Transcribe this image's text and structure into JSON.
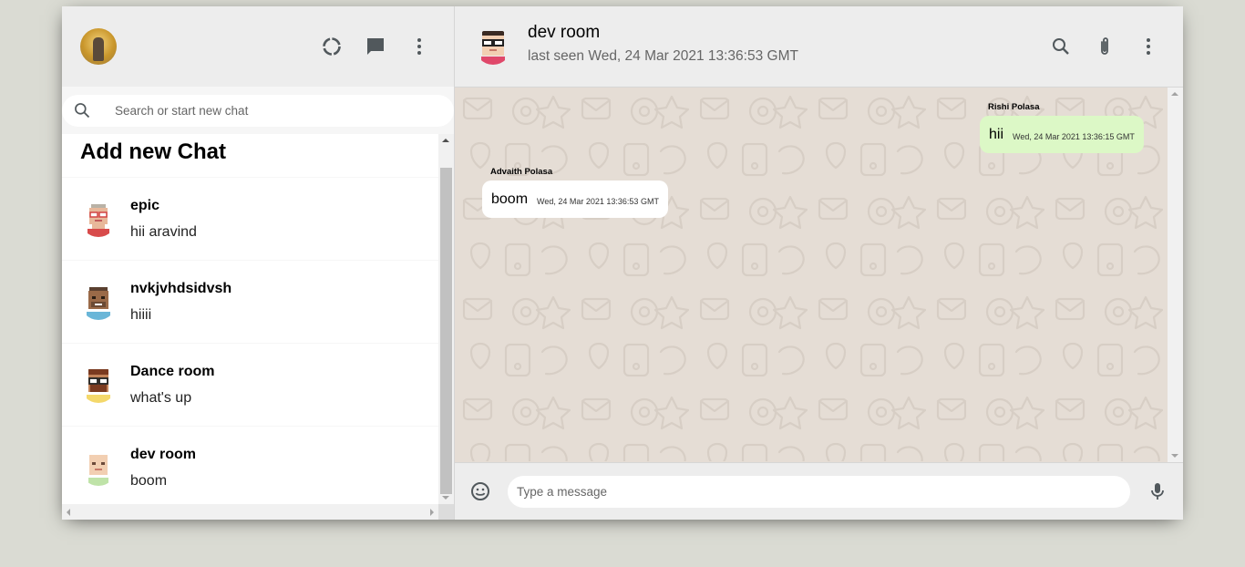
{
  "sidebar": {
    "search_placeholder": "Search or start new chat",
    "add_chat_label": "Add new Chat",
    "chats": [
      {
        "name": "epic",
        "last_message": "hii aravind"
      },
      {
        "name": "nvkjvhdsidvsh",
        "last_message": "hiiii"
      },
      {
        "name": "Dance room",
        "last_message": "what's up"
      },
      {
        "name": "dev room",
        "last_message": "boom"
      }
    ]
  },
  "chat": {
    "room_name": "dev room",
    "last_seen": "last seen Wed, 24 Mar 2021 13:36:53 GMT",
    "messages": [
      {
        "sender": "Rishi Polasa",
        "text": "hii",
        "timestamp": "Wed, 24 Mar 2021 13:36:15 GMT",
        "type": "sent"
      },
      {
        "sender": "Advaith Polasa",
        "text": "boom",
        "timestamp": "Wed, 24 Mar 2021 13:36:53 GMT",
        "type": "received"
      }
    ],
    "input_placeholder": "Type a message"
  },
  "colors": {
    "background": "#dadbd3",
    "header": "#ededed",
    "sent_bubble": "#dcf8c6",
    "received_bubble": "#ffffff",
    "chat_background": "#e5ddd5"
  },
  "icons": {
    "status": "status-icon",
    "new_chat": "chat-icon",
    "menu": "more-vert-icon",
    "search": "search-icon",
    "attach": "attach-icon",
    "emoji": "emoji-icon",
    "mic": "mic-icon"
  }
}
